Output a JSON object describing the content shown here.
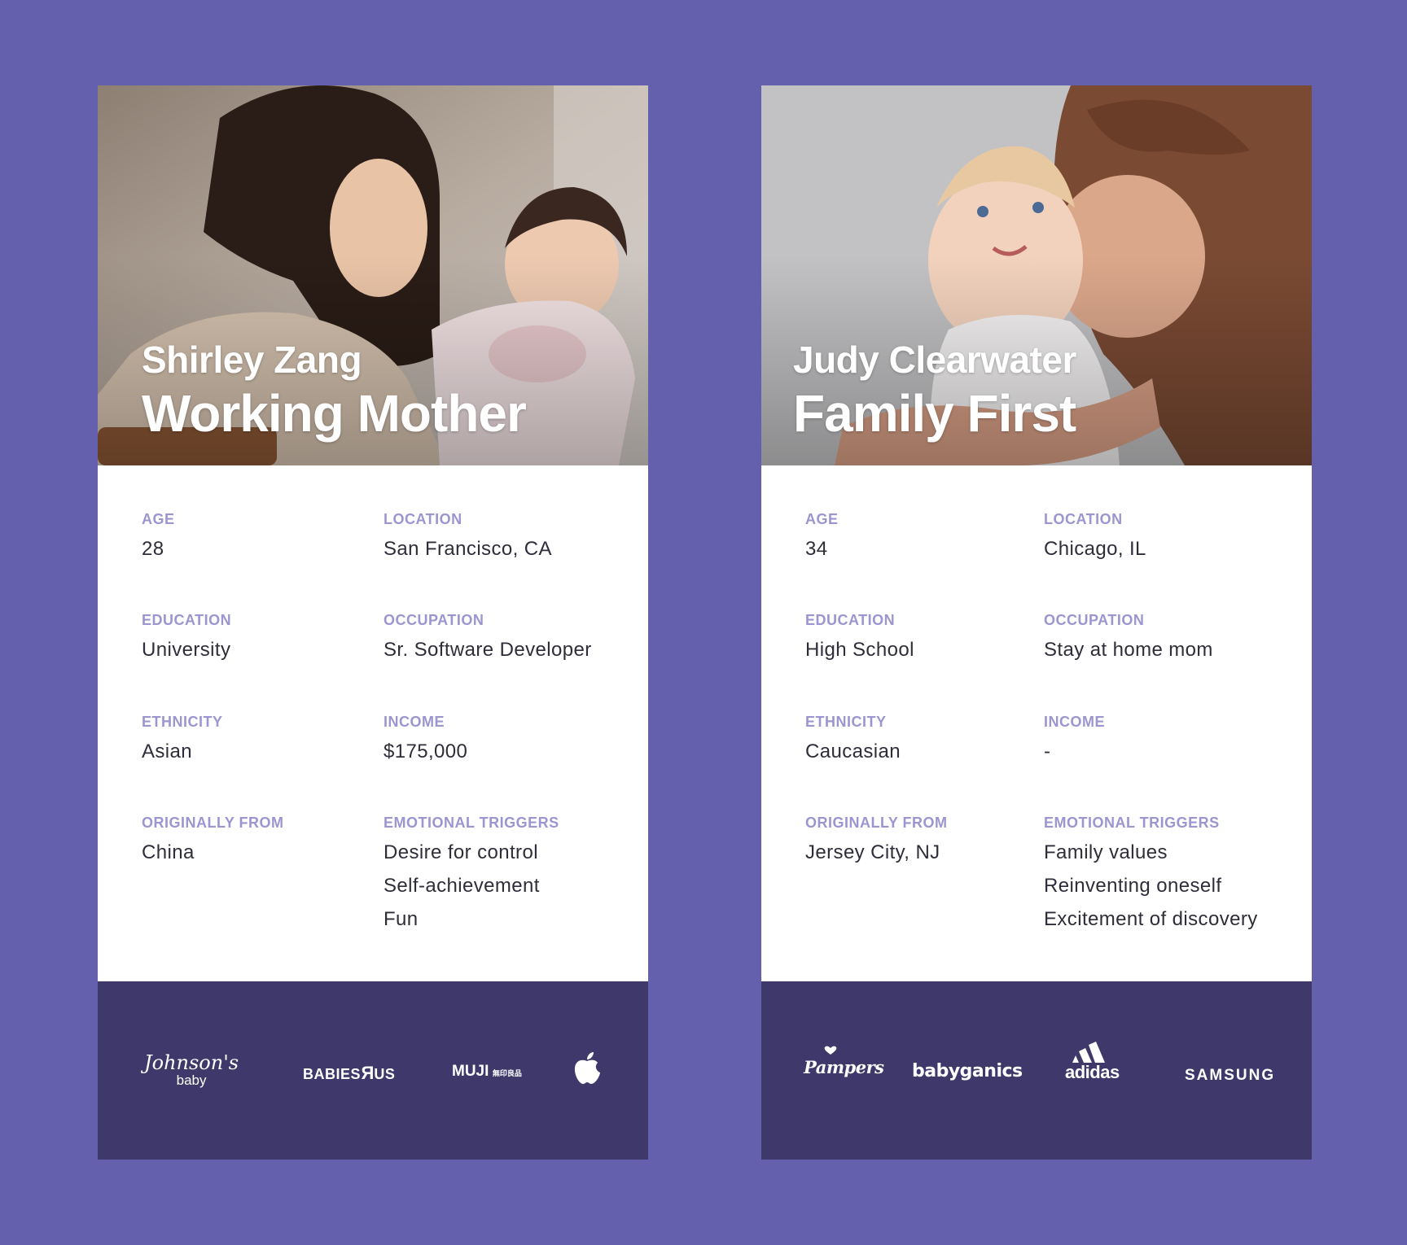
{
  "personas": [
    {
      "name": "Shirley Zang",
      "title": "Working Mother",
      "fields": {
        "age": {
          "label": "AGE",
          "value": "28"
        },
        "location": {
          "label": "LOCATION",
          "value": "San Francisco, CA"
        },
        "education": {
          "label": "EDUCATION",
          "value": "University"
        },
        "occupation": {
          "label": "OCCUPATION",
          "value": "Sr. Software Developer"
        },
        "ethnicity": {
          "label": "ETHNICITY",
          "value": "Asian"
        },
        "income": {
          "label": "INCOME",
          "value": "$175,000"
        },
        "origin": {
          "label": "ORIGINALLY FROM",
          "value": "China"
        },
        "triggers": {
          "label": "EMOTIONAL TRIGGERS",
          "values": [
            "Desire for control",
            "Self-achievement",
            "Fun"
          ]
        }
      },
      "brands": {
        "b1": {
          "word": "Johnson's",
          "sub": "baby"
        },
        "b2": {
          "word": "BABIES",
          "mark": "R",
          "tail": "US"
        },
        "b3": {
          "word": "MUJI",
          "sub": "無印良品"
        },
        "b4": {
          "icon": "apple-icon"
        }
      }
    },
    {
      "name": "Judy Clearwater",
      "title": "Family First",
      "fields": {
        "age": {
          "label": "AGE",
          "value": "34"
        },
        "location": {
          "label": "LOCATION",
          "value": "Chicago, IL"
        },
        "education": {
          "label": "EDUCATION",
          "value": "High School"
        },
        "occupation": {
          "label": "OCCUPATION",
          "value": "Stay at home mom"
        },
        "ethnicity": {
          "label": "ETHNICITY",
          "value": "Caucasian"
        },
        "income": {
          "label": "INCOME",
          "value": "-"
        },
        "origin": {
          "label": "ORIGINALLY FROM",
          "value": "Jersey City, NJ"
        },
        "triggers": {
          "label": "EMOTIONAL TRIGGERS",
          "values": [
            "Family values",
            "Reinventing oneself",
            "Excitement of discovery"
          ]
        }
      },
      "brands": {
        "b1": {
          "word": "Pampers"
        },
        "b2": {
          "word": "babyganics"
        },
        "b3": {
          "word": "adidas",
          "icon": "adidas-stripes-icon"
        },
        "b4": {
          "word": "SAMSUNG"
        }
      }
    }
  ],
  "colors": {
    "page_background": "#6560ad",
    "card_background": "#ffffff",
    "footer_background": "#3e396a",
    "label": "#9b95d0",
    "value": "#2f2d3a"
  }
}
